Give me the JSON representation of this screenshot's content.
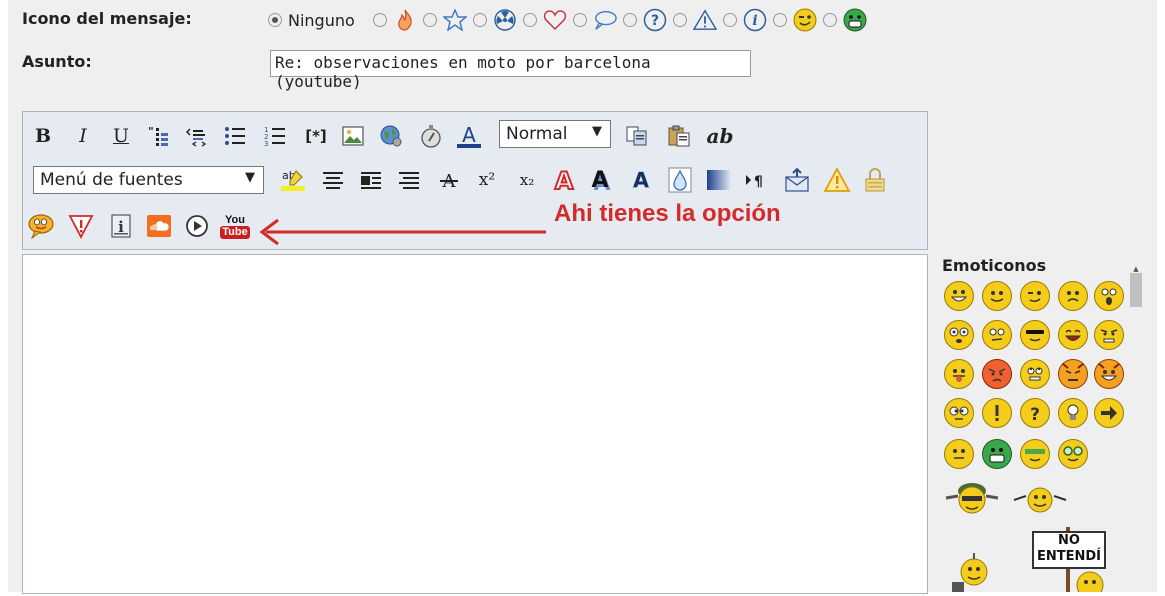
{
  "form": {
    "icon_label": "Icono del mensaje:",
    "none_option": "Ninguno",
    "message_icons": [
      "fire-icon",
      "star-icon",
      "radioactive-icon",
      "heart-icon",
      "speech-bubble-icon",
      "question-icon",
      "warning-icon",
      "info-icon",
      "wink-smiley-icon",
      "green-grin-icon"
    ],
    "subject_label": "Asunto:",
    "subject_value": "Re: observaciones en moto por barcelona (youtube)"
  },
  "toolbar": {
    "bold": "B",
    "italic": "I",
    "underline": "U",
    "list_item": "[*]",
    "font_size_select": "Normal",
    "font_menu_select": "Menú de fuentes",
    "ab_label": "ab",
    "superscript": "x²",
    "subscript": "x₂",
    "youtube_top": "You",
    "youtube_bottom": "Tube"
  },
  "annotation": {
    "text": "Ahi tienes la opción",
    "color": "#d42a2a"
  },
  "emoticons": {
    "title": "Emoticonos",
    "rows": [
      [
        "big-grin",
        "smile",
        "wink",
        "sad",
        "shocked"
      ],
      [
        "eek",
        "confused",
        "cool",
        "laugh",
        "mad"
      ],
      [
        "razz",
        "redface",
        "rolleyes",
        "angry-devil",
        "evil"
      ],
      [
        "crosseyed",
        "exclaim",
        "question",
        "idea",
        "arrow"
      ],
      [
        "neutral",
        "green-grin",
        "nerd-green",
        "glasses"
      ]
    ],
    "sign_text": "NO ENTENDÍ"
  },
  "colors": {
    "accent_red": "#d42a2a",
    "toolbar_bg": "#e6ebf2",
    "youtube_red": "#cc2020"
  }
}
